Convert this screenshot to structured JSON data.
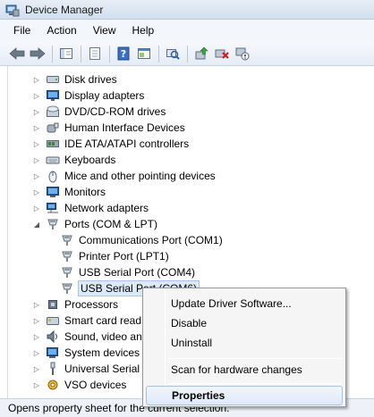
{
  "window": {
    "title": "Device Manager",
    "icon": "device-manager-icon"
  },
  "menu": [
    "File",
    "Action",
    "View",
    "Help"
  ],
  "toolbar": [
    "back-icon",
    "forward-icon",
    "show-hide-tree-icon",
    "properties-icon",
    "help-icon",
    "console-icon",
    "scan-icon",
    "update-driver-icon",
    "uninstall-icon",
    "disable-icon"
  ],
  "tree": {
    "items": [
      {
        "label": "Disk drives",
        "icon": "disk-drive-icon",
        "expander": "▷"
      },
      {
        "label": "Display adapters",
        "icon": "display-adapter-icon",
        "expander": "▷"
      },
      {
        "label": "DVD/CD-ROM drives",
        "icon": "dvd-drive-icon",
        "expander": "▷"
      },
      {
        "label": "Human Interface Devices",
        "icon": "hid-icon",
        "expander": "▷"
      },
      {
        "label": "IDE ATA/ATAPI controllers",
        "icon": "ide-controller-icon",
        "expander": "▷"
      },
      {
        "label": "Keyboards",
        "icon": "keyboard-icon",
        "expander": "▷"
      },
      {
        "label": "Mice and other pointing devices",
        "icon": "mouse-icon",
        "expander": "▷"
      },
      {
        "label": "Monitors",
        "icon": "monitor-icon",
        "expander": "▷"
      },
      {
        "label": "Network adapters",
        "icon": "network-adapter-icon",
        "expander": "▷"
      },
      {
        "label": "Ports (COM & LPT)",
        "icon": "port-icon",
        "expander": "◢"
      },
      {
        "label": "Communications Port (COM1)",
        "icon": "port-icon",
        "expander": ""
      },
      {
        "label": "Printer Port (LPT1)",
        "icon": "port-icon",
        "expander": ""
      },
      {
        "label": "USB Serial Port (COM4)",
        "icon": "port-icon",
        "expander": ""
      },
      {
        "label": "USB Serial Port (COM6)",
        "icon": "port-icon",
        "expander": ""
      },
      {
        "label": "Processors",
        "icon": "processor-icon",
        "expander": "▷"
      },
      {
        "label": "Smart card read",
        "icon": "smart-card-icon",
        "expander": "▷"
      },
      {
        "label": "Sound, video an",
        "icon": "sound-icon",
        "expander": "▷"
      },
      {
        "label": "System devices",
        "icon": "system-device-icon",
        "expander": "▷"
      },
      {
        "label": "Universal Serial I",
        "icon": "usb-icon",
        "expander": "▷"
      },
      {
        "label": "VSO devices",
        "icon": "vso-icon",
        "expander": "▷"
      }
    ]
  },
  "context_menu": {
    "items": [
      "Update Driver Software...",
      "Disable",
      "Uninstall",
      "Scan for hardware changes",
      "Properties"
    ]
  },
  "status": "Opens property sheet for the current selection."
}
